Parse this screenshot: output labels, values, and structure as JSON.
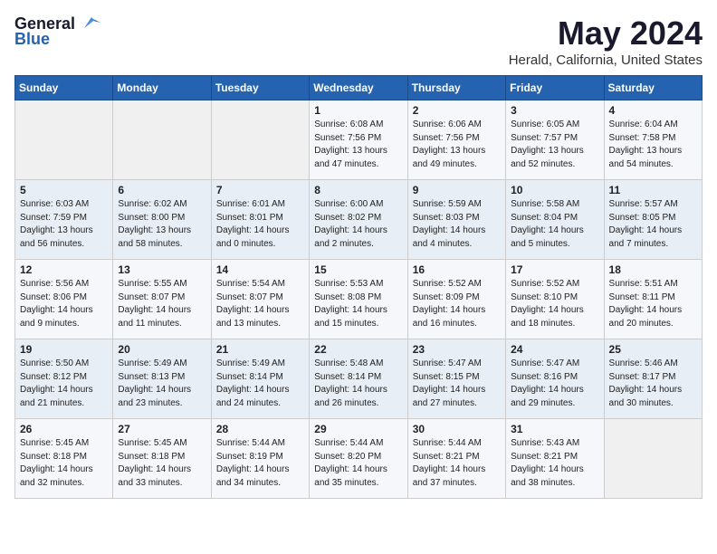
{
  "header": {
    "logo_general": "General",
    "logo_blue": "Blue",
    "title": "May 2024",
    "location": "Herald, California, United States"
  },
  "days_of_week": [
    "Sunday",
    "Monday",
    "Tuesday",
    "Wednesday",
    "Thursday",
    "Friday",
    "Saturday"
  ],
  "weeks": [
    [
      {
        "day": "",
        "info": ""
      },
      {
        "day": "",
        "info": ""
      },
      {
        "day": "",
        "info": ""
      },
      {
        "day": "1",
        "info": "Sunrise: 6:08 AM\nSunset: 7:56 PM\nDaylight: 13 hours\nand 47 minutes."
      },
      {
        "day": "2",
        "info": "Sunrise: 6:06 AM\nSunset: 7:56 PM\nDaylight: 13 hours\nand 49 minutes."
      },
      {
        "day": "3",
        "info": "Sunrise: 6:05 AM\nSunset: 7:57 PM\nDaylight: 13 hours\nand 52 minutes."
      },
      {
        "day": "4",
        "info": "Sunrise: 6:04 AM\nSunset: 7:58 PM\nDaylight: 13 hours\nand 54 minutes."
      }
    ],
    [
      {
        "day": "5",
        "info": "Sunrise: 6:03 AM\nSunset: 7:59 PM\nDaylight: 13 hours\nand 56 minutes."
      },
      {
        "day": "6",
        "info": "Sunrise: 6:02 AM\nSunset: 8:00 PM\nDaylight: 13 hours\nand 58 minutes."
      },
      {
        "day": "7",
        "info": "Sunrise: 6:01 AM\nSunset: 8:01 PM\nDaylight: 14 hours\nand 0 minutes."
      },
      {
        "day": "8",
        "info": "Sunrise: 6:00 AM\nSunset: 8:02 PM\nDaylight: 14 hours\nand 2 minutes."
      },
      {
        "day": "9",
        "info": "Sunrise: 5:59 AM\nSunset: 8:03 PM\nDaylight: 14 hours\nand 4 minutes."
      },
      {
        "day": "10",
        "info": "Sunrise: 5:58 AM\nSunset: 8:04 PM\nDaylight: 14 hours\nand 5 minutes."
      },
      {
        "day": "11",
        "info": "Sunrise: 5:57 AM\nSunset: 8:05 PM\nDaylight: 14 hours\nand 7 minutes."
      }
    ],
    [
      {
        "day": "12",
        "info": "Sunrise: 5:56 AM\nSunset: 8:06 PM\nDaylight: 14 hours\nand 9 minutes."
      },
      {
        "day": "13",
        "info": "Sunrise: 5:55 AM\nSunset: 8:07 PM\nDaylight: 14 hours\nand 11 minutes."
      },
      {
        "day": "14",
        "info": "Sunrise: 5:54 AM\nSunset: 8:07 PM\nDaylight: 14 hours\nand 13 minutes."
      },
      {
        "day": "15",
        "info": "Sunrise: 5:53 AM\nSunset: 8:08 PM\nDaylight: 14 hours\nand 15 minutes."
      },
      {
        "day": "16",
        "info": "Sunrise: 5:52 AM\nSunset: 8:09 PM\nDaylight: 14 hours\nand 16 minutes."
      },
      {
        "day": "17",
        "info": "Sunrise: 5:52 AM\nSunset: 8:10 PM\nDaylight: 14 hours\nand 18 minutes."
      },
      {
        "day": "18",
        "info": "Sunrise: 5:51 AM\nSunset: 8:11 PM\nDaylight: 14 hours\nand 20 minutes."
      }
    ],
    [
      {
        "day": "19",
        "info": "Sunrise: 5:50 AM\nSunset: 8:12 PM\nDaylight: 14 hours\nand 21 minutes."
      },
      {
        "day": "20",
        "info": "Sunrise: 5:49 AM\nSunset: 8:13 PM\nDaylight: 14 hours\nand 23 minutes."
      },
      {
        "day": "21",
        "info": "Sunrise: 5:49 AM\nSunset: 8:14 PM\nDaylight: 14 hours\nand 24 minutes."
      },
      {
        "day": "22",
        "info": "Sunrise: 5:48 AM\nSunset: 8:14 PM\nDaylight: 14 hours\nand 26 minutes."
      },
      {
        "day": "23",
        "info": "Sunrise: 5:47 AM\nSunset: 8:15 PM\nDaylight: 14 hours\nand 27 minutes."
      },
      {
        "day": "24",
        "info": "Sunrise: 5:47 AM\nSunset: 8:16 PM\nDaylight: 14 hours\nand 29 minutes."
      },
      {
        "day": "25",
        "info": "Sunrise: 5:46 AM\nSunset: 8:17 PM\nDaylight: 14 hours\nand 30 minutes."
      }
    ],
    [
      {
        "day": "26",
        "info": "Sunrise: 5:45 AM\nSunset: 8:18 PM\nDaylight: 14 hours\nand 32 minutes."
      },
      {
        "day": "27",
        "info": "Sunrise: 5:45 AM\nSunset: 8:18 PM\nDaylight: 14 hours\nand 33 minutes."
      },
      {
        "day": "28",
        "info": "Sunrise: 5:44 AM\nSunset: 8:19 PM\nDaylight: 14 hours\nand 34 minutes."
      },
      {
        "day": "29",
        "info": "Sunrise: 5:44 AM\nSunset: 8:20 PM\nDaylight: 14 hours\nand 35 minutes."
      },
      {
        "day": "30",
        "info": "Sunrise: 5:44 AM\nSunset: 8:21 PM\nDaylight: 14 hours\nand 37 minutes."
      },
      {
        "day": "31",
        "info": "Sunrise: 5:43 AM\nSunset: 8:21 PM\nDaylight: 14 hours\nand 38 minutes."
      },
      {
        "day": "",
        "info": ""
      }
    ]
  ]
}
